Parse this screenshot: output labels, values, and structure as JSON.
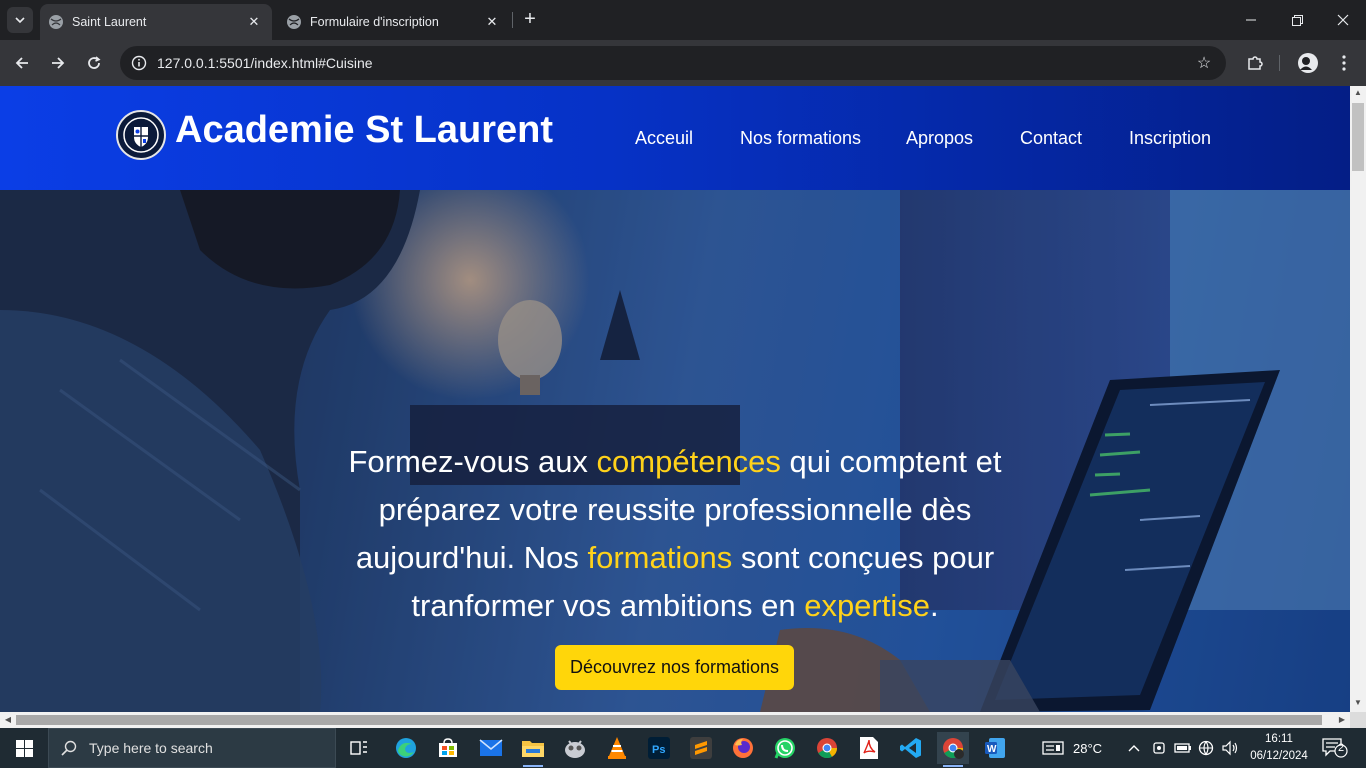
{
  "browser": {
    "tabs": [
      {
        "title": "Saint Laurent",
        "active": true
      },
      {
        "title": "Formulaire d'inscription",
        "active": false
      }
    ],
    "url": "127.0.0.1:5501/index.html#Cuisine"
  },
  "site": {
    "title": "Academie St Laurent",
    "nav": [
      "Acceuil",
      "Nos formations",
      "Apropos",
      "Contact",
      "Inscription"
    ],
    "hero": {
      "line1_a": "Formez-vous aux ",
      "line1_hl": "compétences",
      "line1_b": " qui comptent et",
      "line2": "préparez votre reussite professionnelle dès",
      "line3_a": "aujourd'hui. Nos ",
      "line3_hl": "formations",
      "line3_b": " sont conçues pour",
      "line4_a": "tranformer vos ambitions en ",
      "line4_hl": "expertise",
      "line4_b": "."
    },
    "cta": "Découvrez nos formations",
    "colors": {
      "header_blue": "#0b3ee6",
      "accent_yellow": "#ffd21a",
      "button_yellow": "#ffd60a"
    }
  },
  "taskbar": {
    "search_placeholder": "Type here to search",
    "apps": [
      "task-view",
      "edge",
      "microsoft-store",
      "mail",
      "file-explorer",
      "app",
      "vlc",
      "photoshop",
      "sublime-text",
      "firefox",
      "whatsapp",
      "chrome",
      "pdf-reader",
      "vscode",
      "chrome-active",
      "word"
    ],
    "weather": "28°C",
    "time": "16:11",
    "date": "06/12/2024",
    "notifications": "2"
  }
}
